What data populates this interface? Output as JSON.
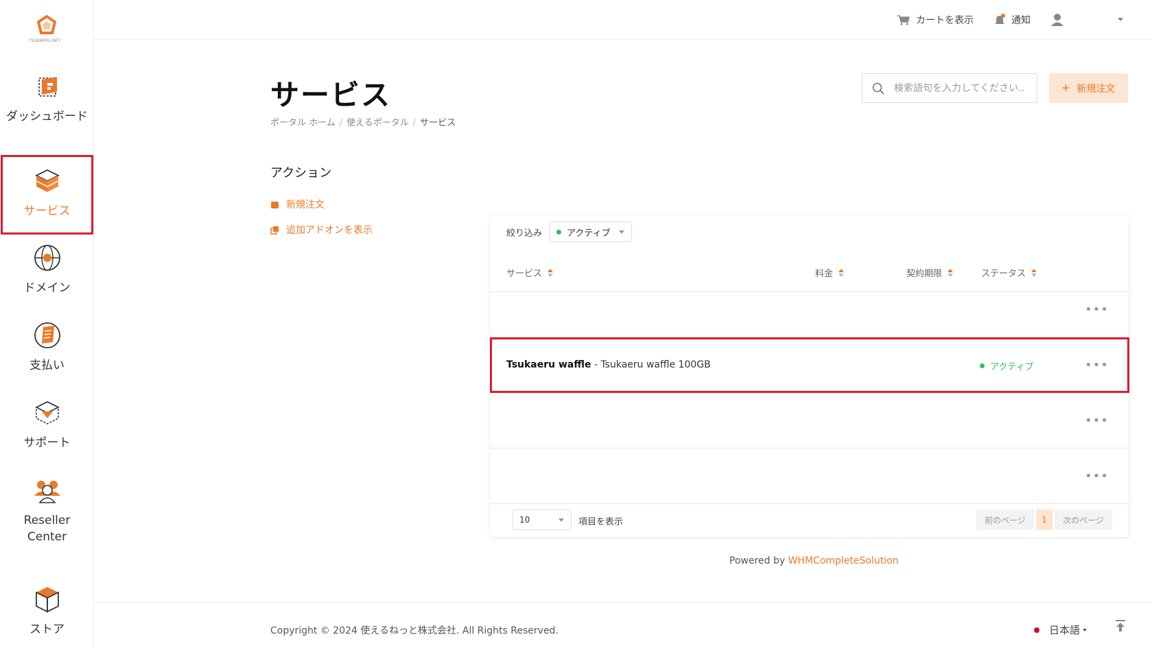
{
  "logo": {
    "text": "TSUKAERU.NET"
  },
  "sidebar": {
    "items": [
      {
        "label": "ダッシュボード",
        "icon": "dashboard-icon"
      },
      {
        "label": "サービス",
        "icon": "box-icon",
        "active": true
      },
      {
        "label": "ドメイン",
        "icon": "globe-icon"
      },
      {
        "label": "支払い",
        "icon": "invoice-icon"
      },
      {
        "label": "サポート",
        "icon": "support-icon"
      },
      {
        "label": "Reseller Center",
        "icon": "users-icon"
      },
      {
        "label": "ストア",
        "icon": "cube-icon"
      }
    ]
  },
  "topbar": {
    "cart": "カートを表示",
    "notifications": "通知"
  },
  "header": {
    "title": "サービス",
    "breadcrumb": [
      "ポータル ホーム",
      "使えるポータル",
      "サービス"
    ],
    "search_placeholder": "検索語句を入力してください..",
    "new_order": "新規注文"
  },
  "actions": {
    "title": "アクション",
    "links": [
      "新規注文",
      "追加アドオンを表示"
    ]
  },
  "table": {
    "filter_label": "絞り込み",
    "filter_value": "アクティブ",
    "columns": [
      "サービス",
      "料金",
      "契約期限",
      "ステータス"
    ],
    "rows": [
      {
        "name": "",
        "detail": "",
        "status": ""
      },
      {
        "name": "Tsukaeru waffle",
        "detail": " - Tsukaeru waffle 100GB",
        "status": "アクティブ"
      },
      {
        "name": "",
        "detail": "",
        "status": ""
      },
      {
        "name": "",
        "detail": "",
        "status": ""
      }
    ],
    "more": "•••",
    "per_page": "10",
    "per_page_label": "項目を表示",
    "prev": "前のページ",
    "page": "1",
    "next": "次のページ"
  },
  "powered": {
    "prefix": "Powered by ",
    "link": "WHMCompleteSolution"
  },
  "footer": {
    "copyright": "Copyright © 2024 使えるねっと株式会社. All Rights Reserved.",
    "language": "日本語"
  },
  "colors": {
    "accent": "#e97a29",
    "success": "#2ebd59",
    "highlight": "#e11b2b"
  }
}
